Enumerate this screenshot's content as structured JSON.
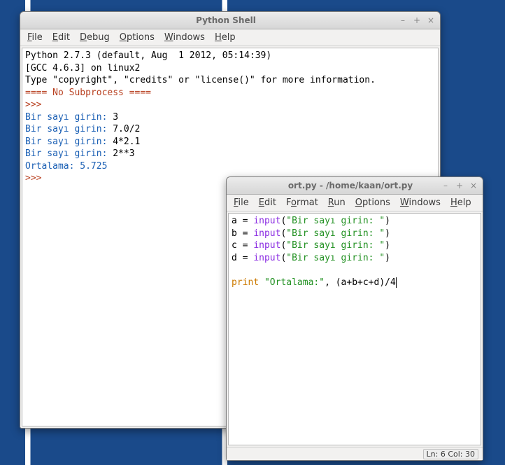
{
  "shell": {
    "title": "Python Shell",
    "menu": {
      "file": "File",
      "edit": "Edit",
      "debug": "Debug",
      "options": "Options",
      "windows": "Windows",
      "help": "Help"
    },
    "controls": {
      "min": "–",
      "max": "+",
      "close": "×"
    },
    "body": {
      "info1": "Python 2.7.3 (default, Aug  1 2012, 05:14:39)",
      "info2": "[GCC 4.6.3] on linux2",
      "info3": "Type \"copyright\", \"credits\" or \"license()\" for more information.",
      "nosub": "==== No Subprocess ====",
      "prompt": ">>>",
      "p1_label": "Bir sayı girin: ",
      "p1_val": "3",
      "p2_label": "Bir sayı girin: ",
      "p2_val": "7.0/2",
      "p3_label": "Bir sayı girin: ",
      "p3_val": "4*2.1",
      "p4_label": "Bir sayı girin: ",
      "p4_val": "2**3",
      "result": "Ortalama: 5.725"
    }
  },
  "editor": {
    "title": "ort.py - /home/kaan/ort.py",
    "menu": {
      "file": "File",
      "edit": "Edit",
      "format": "Format",
      "run": "Run",
      "options": "Options",
      "windows": "Windows",
      "help": "Help"
    },
    "controls": {
      "min": "–",
      "max": "+",
      "close": "×"
    },
    "code": {
      "l1": {
        "p1": "a = ",
        "fn": "input",
        "p2": "(",
        "str": "\"Bir sayı girin: \"",
        "p3": ")"
      },
      "l2": {
        "p1": "b = ",
        "fn": "input",
        "p2": "(",
        "str": "\"Bir sayı girin: \"",
        "p3": ")"
      },
      "l3": {
        "p1": "c = ",
        "fn": "input",
        "p2": "(",
        "str": "\"Bir sayı girin: \"",
        "p3": ")"
      },
      "l4": {
        "p1": "d = ",
        "fn": "input",
        "p2": "(",
        "str": "\"Bir sayı girin: \"",
        "p3": ")"
      },
      "l6": {
        "kw": "print",
        "sp": " ",
        "str": "\"Ortalama:\"",
        "rest": ", (a+b+c+d)/4"
      }
    },
    "status": "Ln: 6 Col: 30"
  }
}
